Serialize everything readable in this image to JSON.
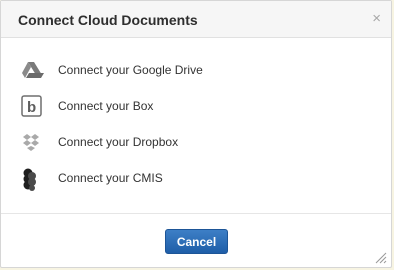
{
  "dialog": {
    "title": "Connect Cloud Documents",
    "close_glyph": "×",
    "options": [
      {
        "label": "Connect your Google Drive",
        "icon": "google-drive-icon"
      },
      {
        "label": "Connect your Box",
        "icon": "box-icon"
      },
      {
        "label": "Connect your Dropbox",
        "icon": "dropbox-icon"
      },
      {
        "label": "Connect your CMIS",
        "icon": "cmis-icon"
      }
    ],
    "cancel_label": "Cancel"
  },
  "colors": {
    "accent": "#2a6bb5",
    "icon_gray": "#777777"
  }
}
